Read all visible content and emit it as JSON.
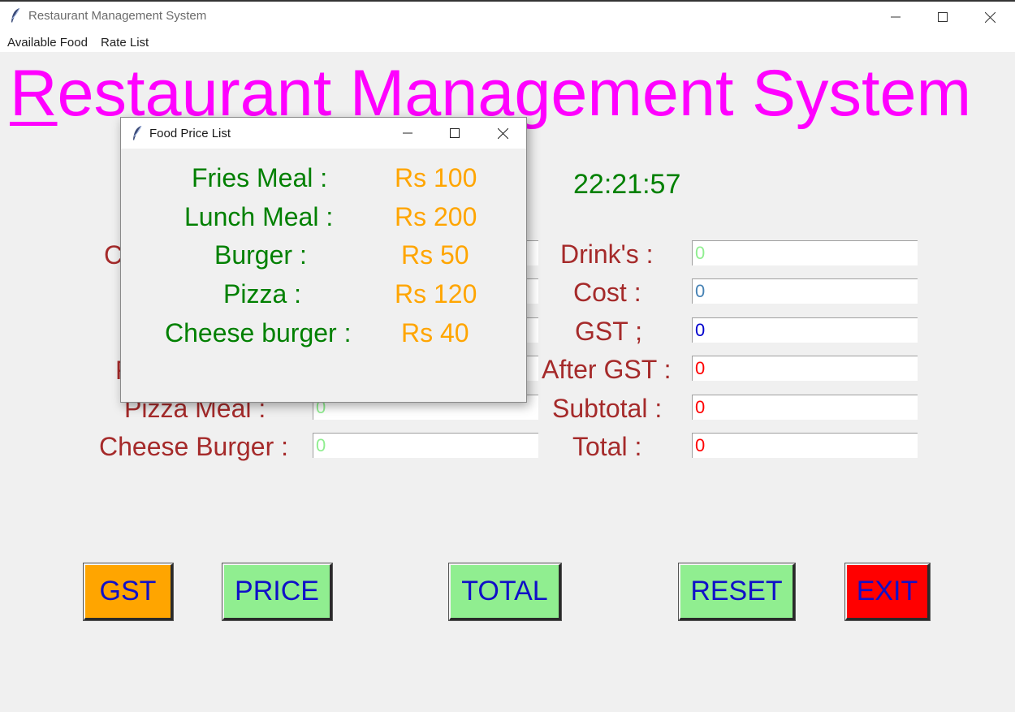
{
  "window": {
    "title": "Restaurant Management System"
  },
  "menu": [
    {
      "label": "Available Food"
    },
    {
      "label": "Rate List"
    }
  ],
  "header": {
    "title_first": "R",
    "title_rest": "estaurant Management System"
  },
  "clock": "22:21:57",
  "left_fields": [
    {
      "label": "Pizza Meal :",
      "value": "0"
    },
    {
      "label": "Cheese Burger :",
      "value": "0"
    }
  ],
  "right_fields": [
    {
      "label": "Drink's :",
      "value": "0",
      "color": "#90ee90"
    },
    {
      "label": "Cost :",
      "value": "0",
      "color": "#4682b4"
    },
    {
      "label": "GST ;",
      "value": "0",
      "color": "#0000cd"
    },
    {
      "label": "After GST :",
      "value": "0",
      "color": "#ff0000"
    },
    {
      "label": "Subtotal :",
      "value": "0",
      "color": "#ff0000"
    },
    {
      "label": "Total :",
      "value": "0",
      "color": "#ff0000"
    }
  ],
  "buttons": [
    {
      "label": "GST",
      "color": "#ffa500"
    },
    {
      "label": "PRICE",
      "color": "#90ee90"
    },
    {
      "label": "TOTAL",
      "color": "#90ee90"
    },
    {
      "label": "RESET",
      "color": "#90ee90"
    },
    {
      "label": "EXIT",
      "color": "#ff0000"
    }
  ],
  "popup": {
    "title": "Food Price List",
    "items": [
      {
        "name": "Fries Meal  :",
        "price": "Rs 100"
      },
      {
        "name": "Lunch Meal  :",
        "price": "Rs 200"
      },
      {
        "name": "Burger  :",
        "price": "Rs 50"
      },
      {
        "name": "Pizza  :",
        "price": "Rs 120"
      },
      {
        "name": "Cheese burger  :",
        "price": "Rs 40"
      }
    ]
  },
  "colors": {
    "title": "#ff00ff",
    "label": "#a52a2a",
    "clock": "#008000",
    "popup_item": "#008000",
    "popup_price": "#ffa500",
    "left_value": "#90ee90",
    "button_text": "#1010c8"
  }
}
